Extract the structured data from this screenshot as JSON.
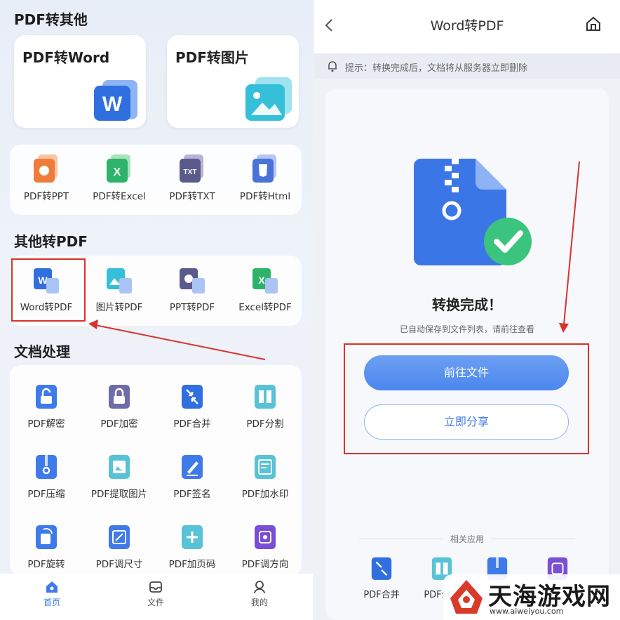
{
  "left": {
    "section1": "PDF转其他",
    "big_cards": [
      "PDF转Word",
      "PDF转图片"
    ],
    "row1": [
      "PDF转PPT",
      "PDF转Excel",
      "PDF转TXT",
      "PDF转Html"
    ],
    "section2": "其他转PDF",
    "row2": [
      "Word转PDF",
      "图片转PDF",
      "PPT转PDF",
      "Excel转PDF"
    ],
    "section3": "文档处理",
    "doc_tools": [
      [
        "PDF解密",
        "PDF加密",
        "PDF合并",
        "PDF分割"
      ],
      [
        "PDF压缩",
        "PDF提取图片",
        "PDF签名",
        "PDF加水印"
      ],
      [
        "PDF旋转",
        "PDF调尺寸",
        "PDF加页码",
        "PDF调方向"
      ]
    ],
    "nav": [
      "首页",
      "文件",
      "我的"
    ]
  },
  "right": {
    "title": "Word转PDF",
    "tip": "提示：转换完成后，文档将从服务器立即删除",
    "done": "转换完成！",
    "subtitle": "已自动保存到文件列表，请前往查看",
    "btn_primary": "前往文件",
    "btn_secondary": "立即分享",
    "related": "相关应用",
    "related_apps": [
      "PDF合并",
      "PDF分割"
    ]
  },
  "watermark": {
    "brand": "天海游戏网",
    "url": "www.aiweiyou.com"
  },
  "colors": {
    "accent": "#4a86ec",
    "highlight": "#d9322e",
    "success": "#3ac47d"
  }
}
